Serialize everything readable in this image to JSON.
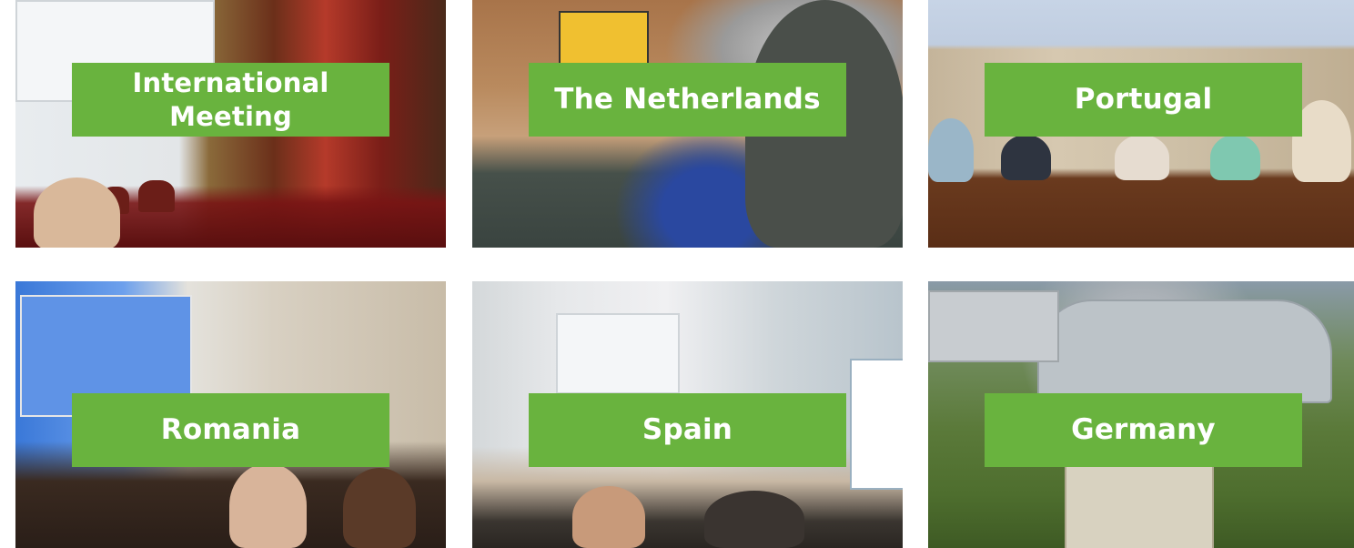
{
  "tiles": [
    {
      "id": "international-meeting",
      "label": "International Meeting"
    },
    {
      "id": "netherlands",
      "label": "The Netherlands"
    },
    {
      "id": "portugal",
      "label": "Portugal"
    },
    {
      "id": "romania",
      "label": "Romania"
    },
    {
      "id": "spain",
      "label": "Spain"
    },
    {
      "id": "germany",
      "label": "Germany"
    }
  ],
  "colors": {
    "label_background": "#69b33e",
    "label_text": "#ffffff",
    "page_background": "#ffffff"
  }
}
